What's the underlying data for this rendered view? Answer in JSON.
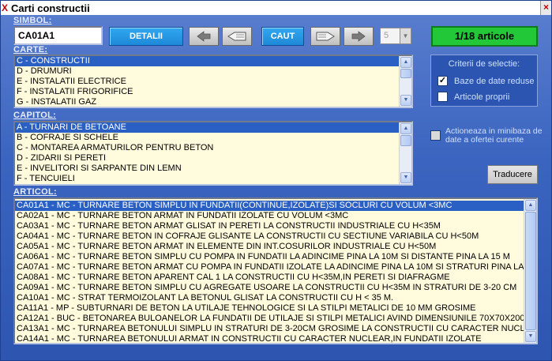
{
  "window": {
    "title": "Carti constructii",
    "close_glyph": "×"
  },
  "simbol": {
    "label": "SIMBOL:",
    "value": "CA01A1"
  },
  "toolbar": {
    "detalii_label": "DETALII",
    "caut_label": "CAUT",
    "spin_value": "5",
    "count_text": "1/18 articole"
  },
  "carte": {
    "label": "CARTE:",
    "items": [
      "C - CONSTRUCTII",
      "D - DRUMURI",
      "E - INSTALATII ELECTRICE",
      "F - INSTALATII FRIGORIFICE",
      "G - INSTALATII GAZ"
    ],
    "selected_index": 0
  },
  "capitol": {
    "label": "CAPITOL:",
    "items": [
      "A - TURNARI DE BETOANE",
      "B - COFRAJE SI SCHELE",
      "C - MONTAREA ARMATURILOR PENTRU BETON",
      "D - ZIDARII SI PERETI",
      "E - INVELITORI SI SARPANTE DIN LEMN",
      "F - TENCUIELI"
    ],
    "selected_index": 0
  },
  "criteria": {
    "title": "Criterii de selectie:",
    "options": [
      {
        "label": "Baze de date reduse",
        "checked": true
      },
      {
        "label": "Articole proprii",
        "checked": false
      }
    ]
  },
  "minibaza": {
    "text": "Actioneaza in minibaza de date a ofertei curente",
    "checked": false
  },
  "traducere_label": "Traducere",
  "articol": {
    "label": "ARTICOL:",
    "items": [
      "CA01A1 - MC - TURNARE BETON SIMPLU IN FUNDATII(CONTINUE,IZOLATE)SI SOCLURI CU VOLUM <3MC",
      "CA02A1 - MC - TURNARE BETON ARMAT IN FUNDATII IZOLATE CU VOLUM <3MC",
      "CA03A1 - MC - TURNARE BETON ARMAT GLISAT IN PERETI LA CONSTRUCTII INDUSTRIALE CU H<35M",
      "CA04A1 - MC - TURNARE BETON IN COFRAJE GLISANTE LA CONSTRUCTII CU SECTIUNE VARIABILA CU H<50M",
      "CA05A1 - MC - TURNARE BETON ARMAT IN ELEMENTE DIN INT.COSURILOR INDUSTRIALE CU H<50M",
      "CA06A1 - MC - TURNARE BETON SIMPLU CU POMPA IN FUNDATII LA ADINCIME PINA LA 10M SI DISTANTE PINA LA 15 M",
      "CA07A1 - MC - TURNARE BETON ARMAT CU POMPA IN FUNDATII IZOLATE LA ADINCIME PINA LA 10M SI STRATURI PINA LA",
      "CA08A1 - MC - TURNARE BETON APARENT CAL 1 LA CONSTRUCTII CU H<35M,IN PERETI SI DIAFRAGME",
      "CA09A1 - MC - TURNARE BETON SIMPLU CU AGREGATE USOARE LA CONSTRUCTII CU H<35M IN STRATURI DE 3-20 CM",
      "CA10A1 - MC - STRAT TERMOIZOLANT LA BETONUL GLISAT LA CONSTRUCTII CU H < 35 M.",
      "CA11A1 - MP - SUBTURNARI DE BETON LA UTILAJE TEHNOLOGICE SI LA STILPI METALICI DE 10 MM GROSIME",
      "CA12A1 - BUC - BETONAREA BULOANELOR LA FUNDATII DE UTILAJE SI STILPI METALICI AVIND DIMENSIUNILE  70X70X200",
      "CA13A1 - MC - TURNAREA BETONULUI SIMPLU IN STRATURI DE 3-20CM GROSIME LA CONSTRUCTII CU CARACTER NUCLEA",
      "CA14A1 - MC - TURNAREA BETONULUI ARMAT IN CONSTRUCTII CU CARACTER NUCLEAR,IN FUNDATII IZOLATE"
    ],
    "selected_index": 0
  }
}
